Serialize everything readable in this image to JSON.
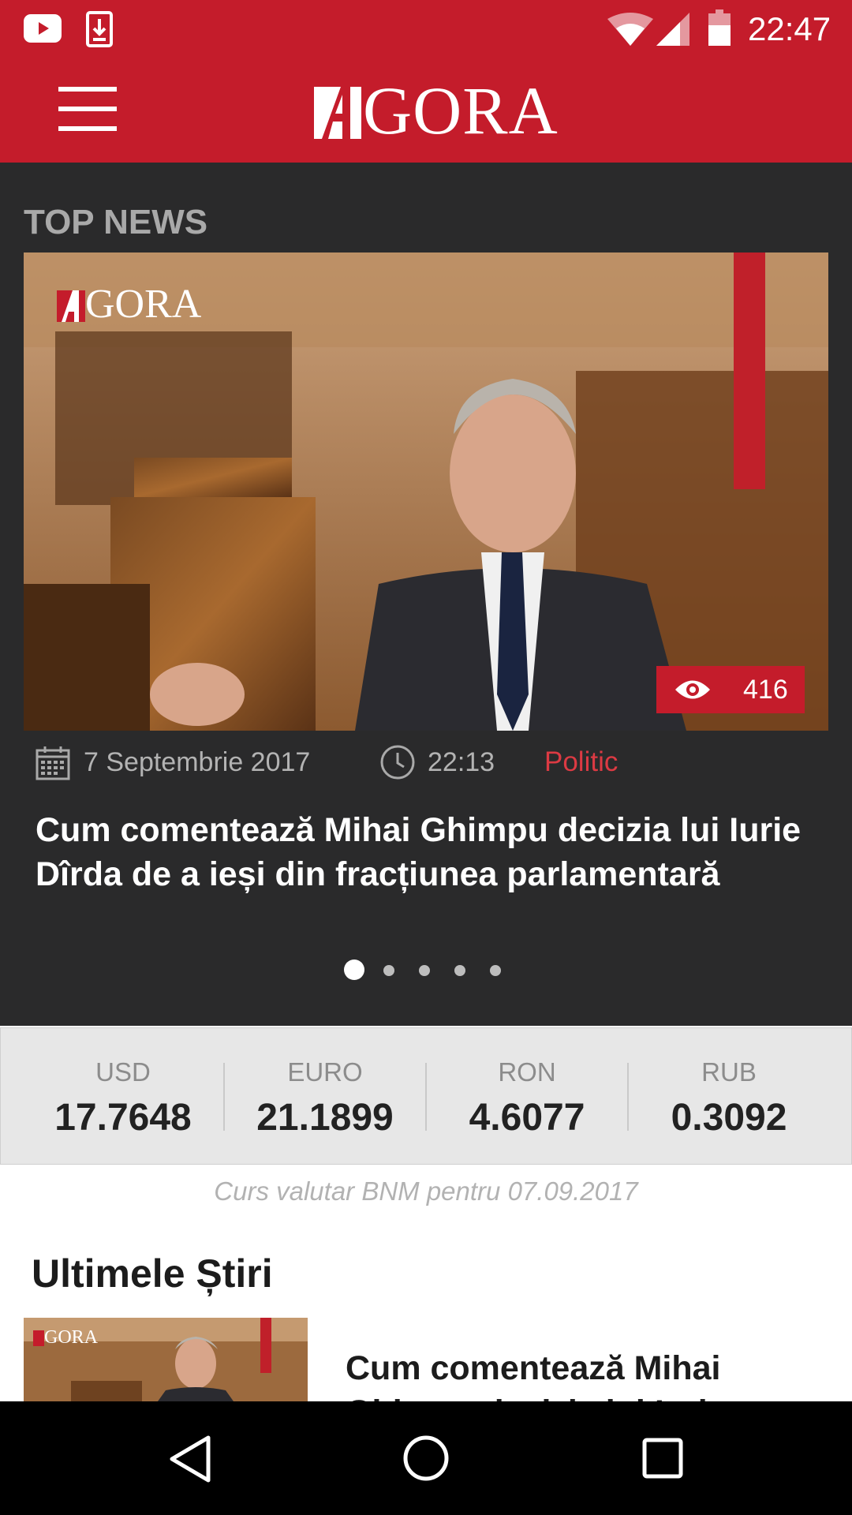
{
  "status_bar": {
    "time": "22:47",
    "icons": [
      "youtube-icon",
      "download-icon",
      "wifi-icon",
      "cell-signal-icon",
      "battery-icon"
    ]
  },
  "app_bar": {
    "brand": "GORA",
    "brand_letter": "A",
    "menu_icon": "hamburger-menu-icon"
  },
  "top_news": {
    "heading": "TOP NEWS",
    "watermark": "GORA",
    "views": "416",
    "date": "7 Septembrie 2017",
    "time": "22:13",
    "category": "Politic",
    "title": "Cum comentează Mihai Ghimpu decizia lui Iurie Dîrda de a ieși din fracțiunea parlamentară",
    "slide_count": 5,
    "active_slide": 1
  },
  "currency": {
    "items": [
      {
        "code": "USD",
        "rate": "17.7648"
      },
      {
        "code": "EURO",
        "rate": "21.1899"
      },
      {
        "code": "RON",
        "rate": "4.6077"
      },
      {
        "code": "RUB",
        "rate": "0.3092"
      }
    ],
    "note": "Curs valutar BNM pentru 07.09.2017"
  },
  "latest": {
    "heading": "Ultimele Știri",
    "items": [
      {
        "thumb_watermark": "GORA",
        "title": "Cum comentează Mihai Ghimpu decizia lui Iurie Dîrda de a ieși din fracțiunea parlamentară"
      }
    ]
  },
  "colors": {
    "brand_red": "#c41c2b",
    "dark_bg": "#2a2a2b",
    "category_red": "#dc3a43",
    "currency_bg": "#e7e7e7"
  },
  "nav_bar": {
    "icons": [
      "back-icon",
      "home-icon",
      "recents-icon"
    ]
  }
}
